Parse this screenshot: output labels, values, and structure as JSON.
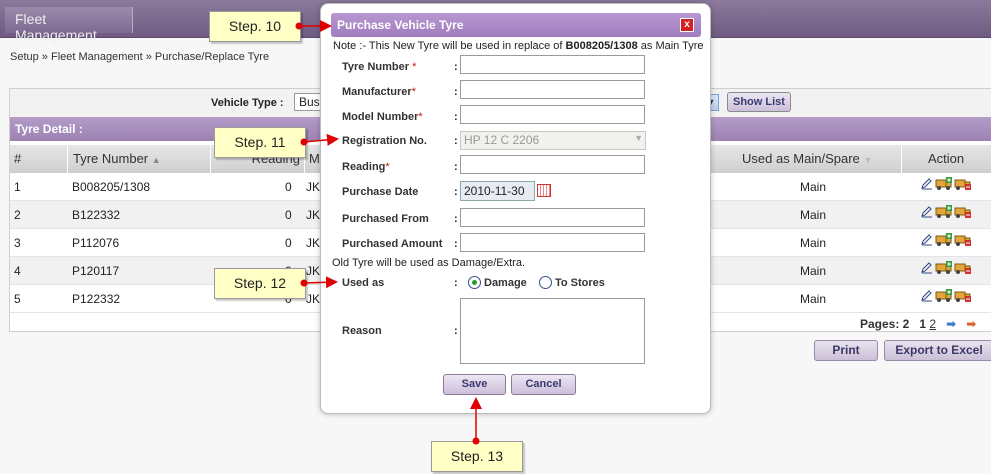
{
  "app": {
    "header_tab": "Fleet Management"
  },
  "breadcrumb": "Setup » Fleet Management » Purchase/Replace Tyre",
  "filter": {
    "vehicle_type_label": "Vehicle Type :",
    "vehicle_type_value": "Bus",
    "show_list_label": "Show List"
  },
  "grid": {
    "title": "Tyre Detail :",
    "columns": {
      "num": "#",
      "tyre_number": "Tyre Number",
      "reading": "Reading",
      "manufacturer": "Ma",
      "used_as": "Used as Main/Spare",
      "action": "Action"
    },
    "rows": [
      {
        "num": "1",
        "tyre_number": "B008205/1308",
        "reading": "0",
        "manufacturer": "JK",
        "used_as": "Main"
      },
      {
        "num": "2",
        "tyre_number": "B122332",
        "reading": "0",
        "manufacturer": "JK",
        "used_as": "Main"
      },
      {
        "num": "3",
        "tyre_number": "P112076",
        "reading": "0",
        "manufacturer": "JK",
        "used_as": "Main"
      },
      {
        "num": "4",
        "tyre_number": "P120117",
        "reading": "0",
        "manufacturer": "JK",
        "used_as": "Main"
      },
      {
        "num": "5",
        "tyre_number": "P122332",
        "reading": "0",
        "manufacturer": "JK",
        "used_as": "Main"
      }
    ],
    "pager": {
      "pages_label": "Pages: 2",
      "page1": "1",
      "page2": "2"
    }
  },
  "buttons": {
    "print": "Print",
    "export": "Export to Excel"
  },
  "modal": {
    "title": "Purchase Vehicle Tyre",
    "close": "x",
    "note_prefix": "Note :- This New Tyre will be used in replace of ",
    "note_tyre": "B008205/1308",
    "note_suffix": " as Main Tyre",
    "fields": {
      "tyre_number": "Tyre Number",
      "manufacturer": "Manufacturer",
      "model_number": "Model Number",
      "registration": "Registration No.",
      "reading": "Reading",
      "purchase_date": "Purchase Date",
      "purchased_from": "Purchased From",
      "purchased_amount": "Purchased Amount",
      "used_as": "Used as",
      "reason": "Reason"
    },
    "required_mark": "*",
    "colon": ":",
    "registration_value": "HP 12 C 2206",
    "purchase_date_value": "2010-11-30",
    "old_tyre_note": "Old Tyre will be used as Damage/Extra.",
    "radio_damage": "Damage",
    "radio_stores": "To Stores",
    "save": "Save",
    "cancel": "Cancel"
  },
  "callouts": {
    "step10": "Step. 10",
    "step11": "Step. 11",
    "step12": "Step. 12",
    "step13": "Step. 13"
  },
  "colors": {
    "header": "#6f5b82",
    "modal_title": "#a07cbe",
    "callout_bg": "#ffffc6",
    "arrow": "#e00000"
  }
}
